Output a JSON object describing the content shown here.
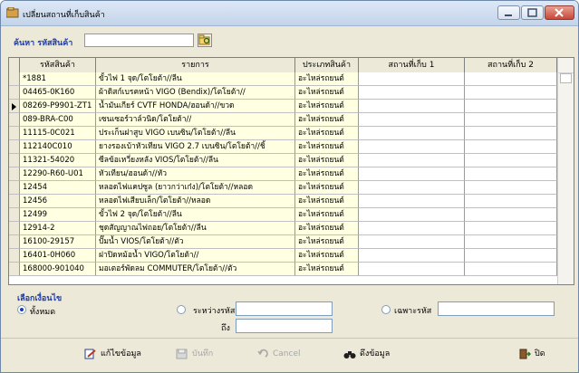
{
  "window": {
    "title": "เปลี่ยนสถานที่เก็บสินค้า"
  },
  "search": {
    "label": "ค้นหา รหัสสินค้า",
    "value": ""
  },
  "table": {
    "columns": [
      "รหัสสินค้า",
      "รายการ",
      "ประเภทสินค้า",
      "สถานที่เก็บ 1",
      "สถานที่เก็บ 2"
    ],
    "selected_row": 2,
    "rows": [
      {
        "id": "*1881",
        "name": "ขั้วไฟ 1 จุด/โตโยต้า//ลีน",
        "type": "อะไหล่รถยนต์",
        "loc1": "",
        "loc2": ""
      },
      {
        "id": "04465-0K160",
        "name": "ผ้าดิสก์เบรคหน้า VIGO (Bendix)/โตโยต้า//",
        "type": "อะไหล่รถยนต์",
        "loc1": "",
        "loc2": ""
      },
      {
        "id": "08269-P9901-ZT1",
        "name": "น้ำมันเกียร์ CVTF HONDA/ฮอนด้า//ขวด",
        "type": "อะไหล่รถยนต์",
        "loc1": "",
        "loc2": ""
      },
      {
        "id": "089-BRA-C00",
        "name": "เซนเซอร์วาล์วนิด/โตโยต้า//",
        "type": "อะไหล่รถยนต์",
        "loc1": "",
        "loc2": ""
      },
      {
        "id": "11115-0C021",
        "name": "ประเก็นฝาสูบ VIGO เบนซิน/โตโยต้า//ลีน",
        "type": "อะไหล่รถยนต์",
        "loc1": "",
        "loc2": ""
      },
      {
        "id": "112140C010",
        "name": "ยางรองเบ้าหัวเทียน VIGO 2.7 เบนซิน/โตโยต้า//ชิ้",
        "type": "อะไหล่รถยนต์",
        "loc1": "",
        "loc2": ""
      },
      {
        "id": "11321-54020",
        "name": "ซีลข้อเหวี่ยงหลัง VIOS/โตโยต้า//ลีน",
        "type": "อะไหล่รถยนต์",
        "loc1": "",
        "loc2": ""
      },
      {
        "id": "12290-R60-U01",
        "name": "หัวเทียน/ฮอนด้า//หัว",
        "type": "อะไหล่รถยนต์",
        "loc1": "",
        "loc2": ""
      },
      {
        "id": "12454",
        "name": "หลอดไฟแคปซูล (ยาวกว่าเก๋ง)/โตโยต้า//หลอด",
        "type": "อะไหล่รถยนต์",
        "loc1": "",
        "loc2": ""
      },
      {
        "id": "12456",
        "name": "หลอดไฟเสียบเล็ก/โตโยต้า//หลอด",
        "type": "อะไหล่รถยนต์",
        "loc1": "",
        "loc2": ""
      },
      {
        "id": "12499",
        "name": "ขั้วไฟ 2 จุด/โตโยต้า//ลีน",
        "type": "อะไหล่รถยนต์",
        "loc1": "",
        "loc2": ""
      },
      {
        "id": "12914-2",
        "name": "ชุดสัญญาณไฟถอย/โตโยต้า//ลีน",
        "type": "อะไหล่รถยนต์",
        "loc1": "",
        "loc2": ""
      },
      {
        "id": "16100-29157",
        "name": "ปั๊มน้ำ VIOS/โตโยต้า//ตัว",
        "type": "อะไหล่รถยนต์",
        "loc1": "",
        "loc2": ""
      },
      {
        "id": "16401-0H060",
        "name": "ฝาปิดหม้อน้ำ VIGO/โตโยต้า//",
        "type": "อะไหล่รถยนต์",
        "loc1": "",
        "loc2": ""
      },
      {
        "id": "168000-901040",
        "name": "มอเตอร์พัดลม COMMUTER/โตโยต้า//ตัว",
        "type": "อะไหล่รถยนต์",
        "loc1": "",
        "loc2": ""
      }
    ]
  },
  "filters": {
    "label": "เลือกเงื่อนไข",
    "all_label": "ทั้งหมด",
    "range_label": "ระหว่างรหัส",
    "to_label": "ถึง",
    "only_label": "เฉพาะรหัส",
    "selected": "all",
    "range_from": "",
    "range_to": "",
    "only_code": ""
  },
  "toolbar": {
    "edit": "แก้ไขข้อมูล",
    "save": "บันทึก",
    "cancel": "Cancel",
    "fetch": "ดึงข้อมูล",
    "close": "ปิด"
  },
  "colors": {
    "accent": "#1b3bb3",
    "row_highlight": "#ffffe1"
  }
}
